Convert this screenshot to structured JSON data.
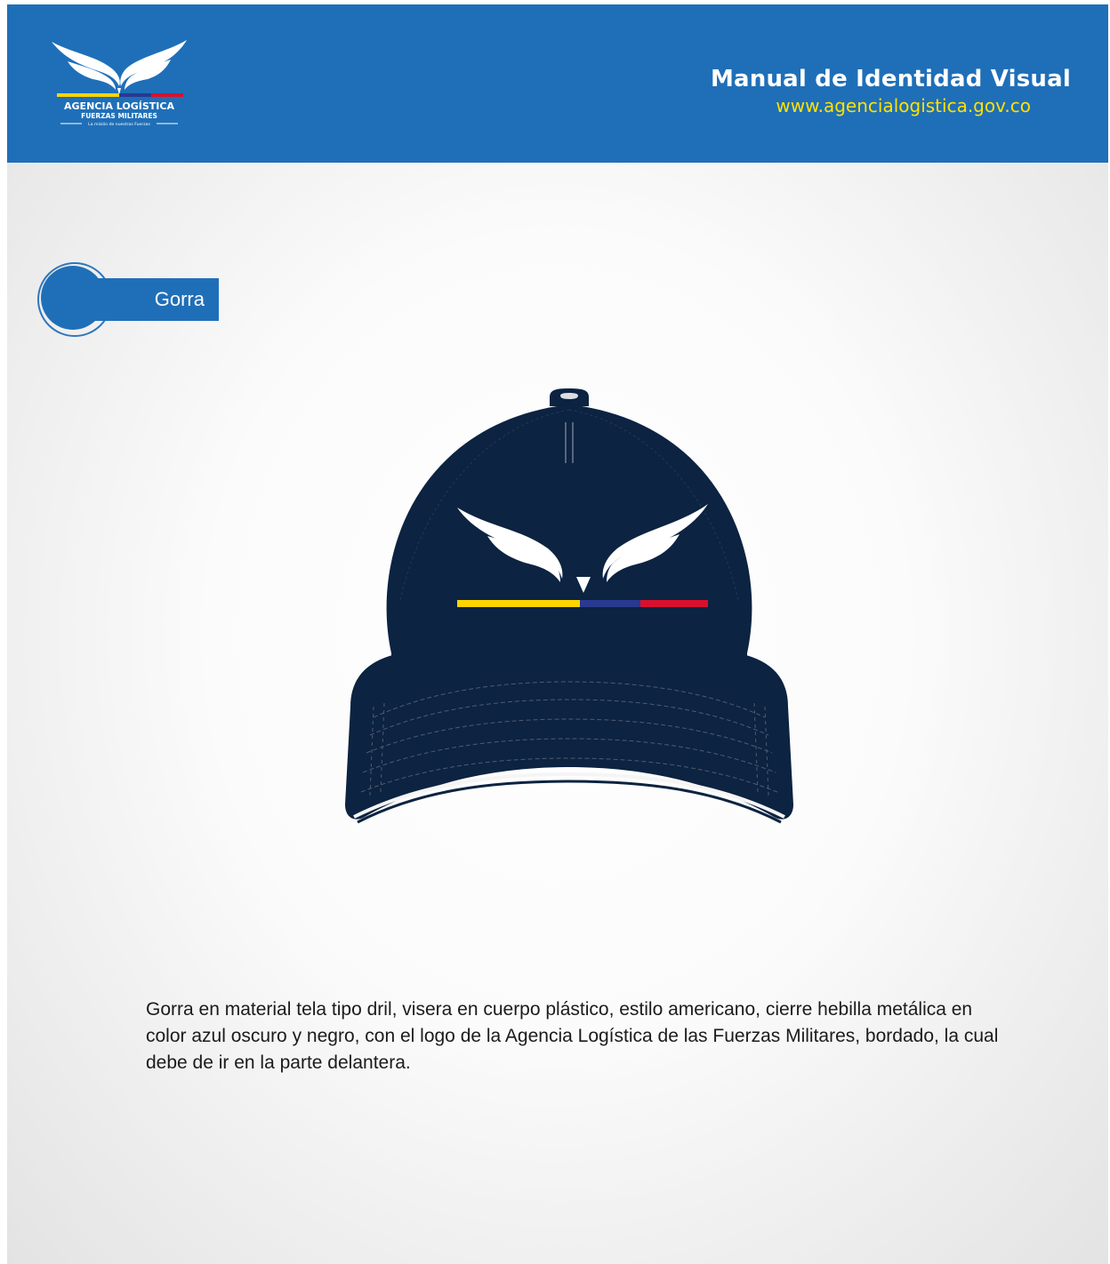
{
  "header": {
    "title": "Manual de Identidad Visual",
    "url": "www.agencialogistica.gov.co",
    "logo": {
      "line1": "AGENCIA LOGÍSTICA",
      "line2": "FUERZAS MILITARES",
      "line3": "La misión de nuestras Fuerzas"
    }
  },
  "section": {
    "title": "Gorra"
  },
  "description": "Gorra en material tela tipo dril, visera en cuerpo plástico, estilo americano, cierre hebilla metálica en color azul oscuro y negro, con el logo de la Agencia Logística de las Fuerzas Militares, bordado, la cual debe de ir en la parte delantera.",
  "colors": {
    "header_blue": "#1f6fb8",
    "url_yellow": "#ffe100",
    "cap_navy": "#0c2341",
    "flag_yellow": "#ffd400",
    "flag_blue": "#28398f",
    "flag_red": "#d8102f"
  },
  "icons": {
    "logo": "wings-logo-icon",
    "product": "cap-illustration"
  }
}
